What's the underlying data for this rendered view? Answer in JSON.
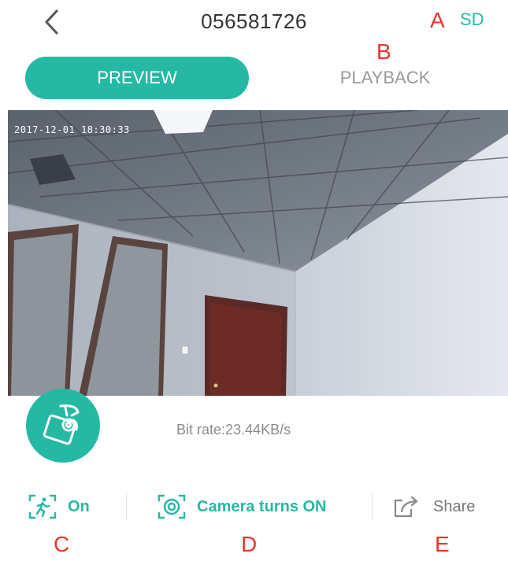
{
  "header": {
    "title": "056581726",
    "sd_label": "SD",
    "marker_a": "A"
  },
  "tabs": {
    "preview_label": "PREVIEW",
    "playback_label": "PLAYBACK",
    "marker_b": "B"
  },
  "video": {
    "timestamp": "2017-12-01 18:30:33"
  },
  "status": {
    "bit_rate": "Bit rate:23.44KB/s"
  },
  "controls": {
    "motion_label": "On",
    "camera_label": "Camera turns ON",
    "share_label": "Share"
  },
  "markers": {
    "c": "C",
    "d": "D",
    "e": "E"
  },
  "colors": {
    "accent": "#25b9a4",
    "marker": "#e8352b"
  },
  "icons": [
    "back-arrow-icon",
    "ptz-camera-icon",
    "motion-detection-icon",
    "camera-power-icon",
    "share-icon"
  ]
}
